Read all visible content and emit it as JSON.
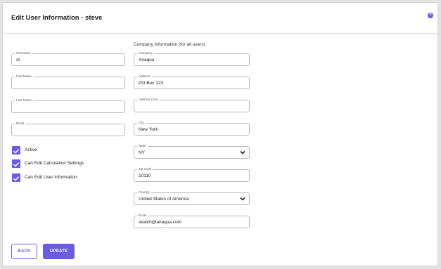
{
  "header": {
    "title": "Edit User Information - steve",
    "help_icon": "question-circle-icon"
  },
  "company_section": {
    "title": "Company Information (for all users)"
  },
  "user_fields": {
    "username": {
      "label": "Username",
      "value": "st"
    },
    "first_name": {
      "label": "First Name",
      "value": ""
    },
    "last_name": {
      "label": "Last Name",
      "value": ""
    },
    "email": {
      "label": "Email",
      "value": ""
    }
  },
  "checkboxes": [
    {
      "label": "Active",
      "checked": true
    },
    {
      "label": "Can Edit Calculation Settings",
      "checked": true
    },
    {
      "label": "Can Edit User Information",
      "checked": true
    }
  ],
  "company_fields": {
    "company": {
      "label": "Company",
      "value": "Anaqua"
    },
    "address": {
      "label": "Address",
      "value": "PO Box 123"
    },
    "address_cont": {
      "label": "Address Cont",
      "value": ""
    },
    "city": {
      "label": "City",
      "value": "New York"
    },
    "state": {
      "label": "State",
      "value": "NY"
    },
    "zip": {
      "label": "Zip Code",
      "value": "10110"
    },
    "country": {
      "label": "Country",
      "value": "United States of America"
    },
    "email": {
      "label": "Email",
      "value": "skatch@anaqua.com"
    }
  },
  "buttons": {
    "back": "BACK",
    "update": "UPDATE"
  },
  "colors": {
    "accent": "#6a5de0"
  }
}
